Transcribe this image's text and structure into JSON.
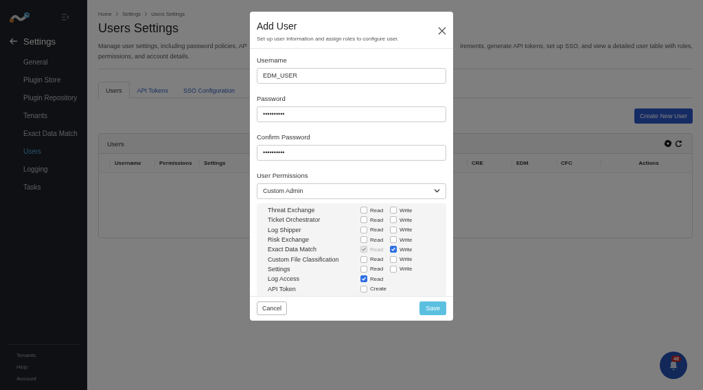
{
  "sidebar": {
    "title": "Settings",
    "items": [
      {
        "label": "General",
        "selected": false
      },
      {
        "label": "Plugin Store",
        "selected": false
      },
      {
        "label": "Plugin Repository",
        "selected": false
      },
      {
        "label": "Tenants",
        "selected": false
      },
      {
        "label": "Exact Data Match",
        "selected": false
      },
      {
        "label": "Users",
        "selected": true
      },
      {
        "label": "Logging",
        "selected": false
      },
      {
        "label": "Tasks",
        "selected": false
      }
    ],
    "footer_items": [
      "Tenants",
      "Help",
      "Account"
    ]
  },
  "breadcrumb": [
    "Home",
    "Settings",
    "Users Settings"
  ],
  "page_title": "Users Settings",
  "description": {
    "line_1_left": "Manage user settings, including password policies, AP",
    "line_1_right": "irements, generate API tokens, set up SSO, and view a detailed user table with roles,",
    "line_2": "permissions, and account details."
  },
  "tabs": [
    {
      "label": "Users",
      "selected": true
    },
    {
      "label": "API Tokens",
      "selected": false
    },
    {
      "label": "SSO Configuration",
      "selected": false
    }
  ],
  "create_button": "Create New User",
  "users_panel": {
    "title": "Users",
    "columns_left": [
      "Username",
      "Permissions",
      "Settings"
    ],
    "columns_right": [
      "CRE",
      "EDM",
      "CFC",
      "Actions"
    ]
  },
  "notifications": {
    "count": "48"
  },
  "dialog": {
    "title": "Add User",
    "subtitle": "Set up user information and assign roles to configure user.",
    "fields": [
      {
        "label": "Username",
        "value": "EDM_USER"
      },
      {
        "label": "Password",
        "value": "••••••••••"
      },
      {
        "label": "Confirm Password",
        "value": "••••••••••"
      }
    ],
    "permissions_label": "User Permissions",
    "role": "Custom Admin",
    "permissions": [
      {
        "name": "Threat Exchange",
        "options": [
          {
            "label": "Read",
            "checked": false,
            "disabled": false
          },
          {
            "label": "Write",
            "checked": false,
            "disabled": false
          }
        ]
      },
      {
        "name": "Ticket Orchestrator",
        "options": [
          {
            "label": "Read",
            "checked": false,
            "disabled": false
          },
          {
            "label": "Write",
            "checked": false,
            "disabled": false
          }
        ]
      },
      {
        "name": "Log Shipper",
        "options": [
          {
            "label": "Read",
            "checked": false,
            "disabled": false
          },
          {
            "label": "Write",
            "checked": false,
            "disabled": false
          }
        ]
      },
      {
        "name": "Risk Exchange",
        "options": [
          {
            "label": "Read",
            "checked": false,
            "disabled": false
          },
          {
            "label": "Write",
            "checked": false,
            "disabled": false
          }
        ]
      },
      {
        "name": "Exact Data Match",
        "options": [
          {
            "label": "Read",
            "checked": true,
            "disabled": true
          },
          {
            "label": "Write",
            "checked": true,
            "disabled": false
          }
        ]
      },
      {
        "name": "Custom File Classification",
        "options": [
          {
            "label": "Read",
            "checked": false,
            "disabled": false
          },
          {
            "label": "Write",
            "checked": false,
            "disabled": false
          }
        ]
      },
      {
        "name": "Settings",
        "options": [
          {
            "label": "Read",
            "checked": false,
            "disabled": false
          },
          {
            "label": "Write",
            "checked": false,
            "disabled": false
          }
        ]
      },
      {
        "name": "Log Access",
        "options": [
          {
            "label": "Read",
            "checked": true,
            "disabled": false
          }
        ]
      },
      {
        "name": "API Token",
        "options": [
          {
            "label": "Create",
            "checked": false,
            "disabled": false
          }
        ]
      }
    ],
    "cancel": "Cancel",
    "save": "Save"
  }
}
